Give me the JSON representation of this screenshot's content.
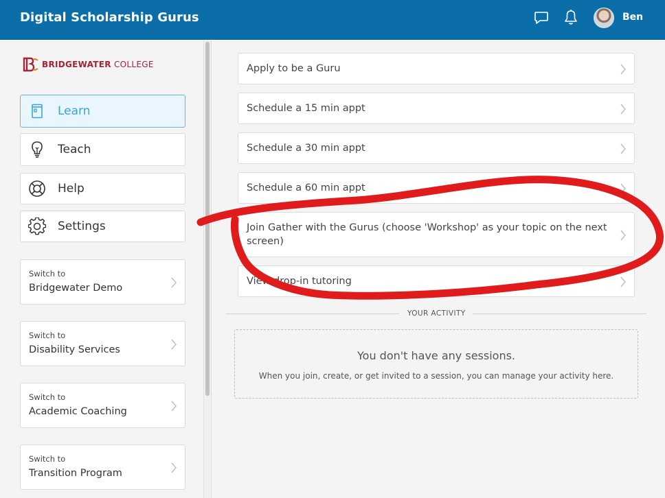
{
  "header": {
    "app_title": "Digital Scholarship Gurus",
    "user_name": "Ben",
    "chat_icon": "chat-bubble-icon",
    "bell_icon": "bell-icon"
  },
  "sidebar": {
    "logo": {
      "bold": "BRIDGEWATER",
      "light": " COLLEGE"
    },
    "nav": [
      {
        "label": "Learn",
        "icon": "book-icon",
        "active": true
      },
      {
        "label": "Teach",
        "icon": "lightbulb-icon"
      },
      {
        "label": "Help",
        "icon": "lifebuoy-icon"
      },
      {
        "label": "Settings",
        "icon": "gear-icon"
      }
    ],
    "switch_items": [
      {
        "small": "Switch to",
        "name": "Bridgewater Demo"
      },
      {
        "small": "Switch to",
        "name": "Disability Services"
      },
      {
        "small": "Switch to",
        "name": "Academic Coaching"
      },
      {
        "small": "Switch to",
        "name": "Transition Program"
      }
    ]
  },
  "main": {
    "links": [
      {
        "label": "Apply to be a Guru"
      },
      {
        "label": "Schedule a 15 min appt"
      },
      {
        "label": "Schedule a 30 min appt"
      },
      {
        "label": "Schedule a 60 min appt"
      },
      {
        "label": "Join Gather with the Gurus (choose 'Workshop' as your topic on the next screen)"
      },
      {
        "label": "View drop-in tutoring"
      }
    ],
    "activity": {
      "heading": "YOUR ACTIVITY",
      "empty_title": "You don't have any sessions.",
      "empty_desc": "When you join, create, or get invited to a session, you can manage your activity here."
    }
  },
  "colors": {
    "header_bg": "#0b6ea8",
    "active_accent": "#3aa3dc",
    "brand_red": "#a32337",
    "annotation_red": "#e01b1b"
  }
}
